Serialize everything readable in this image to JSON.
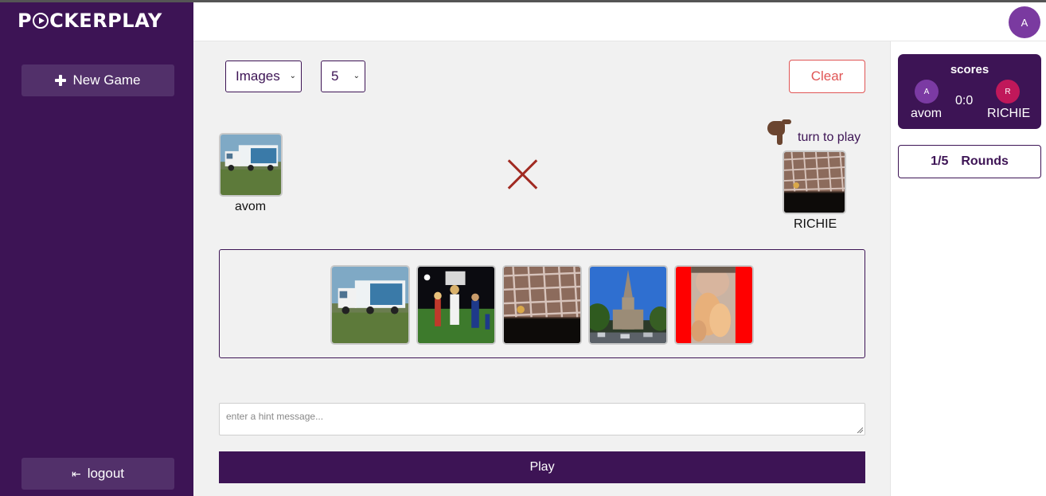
{
  "app": {
    "logo_text_1": "P",
    "logo_text_2": "CKERPLAY"
  },
  "sidebar": {
    "new_game_label": "New Game",
    "logout_label": "logout"
  },
  "header": {
    "user_initial": "A"
  },
  "controls": {
    "type_select_value": "Images",
    "count_select_value": "5",
    "clear_label": "Clear"
  },
  "game": {
    "player_left_name": "avom",
    "player_right_name": "RICHIE",
    "turn_text": "turn to play",
    "cards": [
      "truck",
      "cheerleaders",
      "cage",
      "church",
      "person-with-cat"
    ]
  },
  "hint": {
    "placeholder": "enter a hint message..."
  },
  "play_label": "Play",
  "scores": {
    "title": "scores",
    "player_a_initial": "A",
    "player_a_name": "avom",
    "player_r_initial": "R",
    "player_r_name": "RICHIE",
    "score": "0:0"
  },
  "rounds": {
    "count": "1/5",
    "label": "Rounds"
  },
  "colors": {
    "brand": "#3d1455",
    "clear": "#e05555",
    "x_mark": "#a12a22"
  }
}
